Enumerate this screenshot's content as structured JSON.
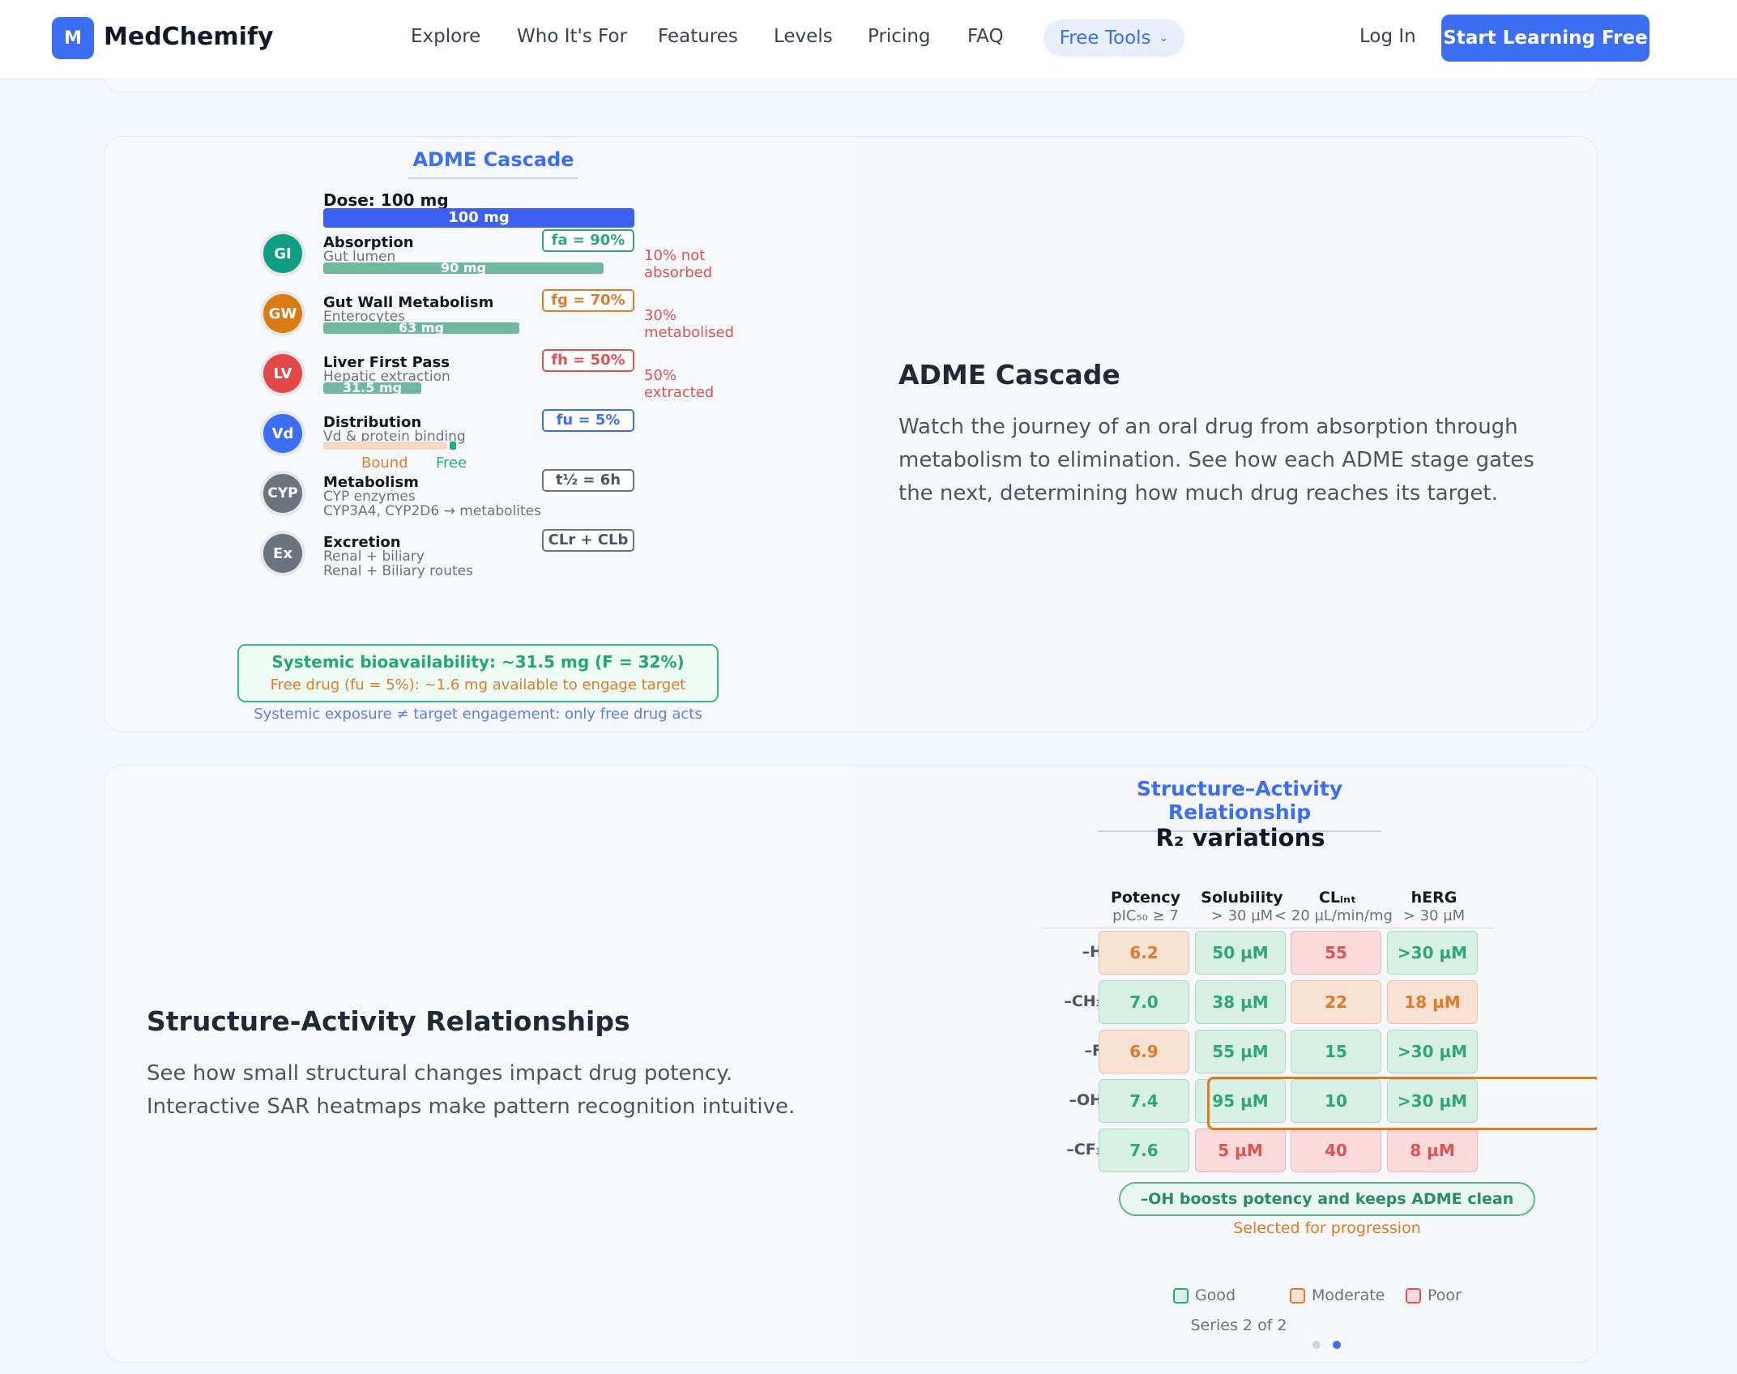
{
  "nav": {
    "logo_letter": "M",
    "brand": "MedChemify",
    "links": [
      "Explore",
      "Who It's For",
      "Features",
      "Levels",
      "Pricing",
      "FAQ"
    ],
    "free_tools": "Free Tools",
    "login": "Log In",
    "cta": "Start Learning Free"
  },
  "adme": {
    "heading": "ADME Cascade",
    "dose_label": "Dose: 100 mg",
    "dose_bar": "100 mg",
    "stages": [
      {
        "badge": "GI",
        "name": "Absorption",
        "sub": "Gut lumen",
        "bar": "90 mg",
        "fraction": 0.9,
        "pill": "fa = 90%",
        "loss1": "10% not",
        "loss2": "absorbed",
        "color": "#0f9d83"
      },
      {
        "badge": "GW",
        "name": "Gut Wall Metabolism",
        "sub": "Enterocytes",
        "bar": "63 mg",
        "fraction": 0.63,
        "pill": "fg = 70%",
        "loss1": "30%",
        "loss2": "metabolised",
        "color": "#d97a12"
      },
      {
        "badge": "LV",
        "name": "Liver First Pass",
        "sub": "Hepatic extraction",
        "bar": "31.5 mg",
        "fraction": 0.315,
        "pill": "fh = 50%",
        "loss1": "50%",
        "loss2": "extracted",
        "color": "#e24848"
      },
      {
        "badge": "Vd",
        "name": "Distribution",
        "sub": "Vd & protein binding",
        "pill": "fu = 5%",
        "bound": "Bound",
        "free": "Free",
        "color": "#3b6ef2"
      },
      {
        "badge": "CYP",
        "name": "Metabolism",
        "sub": "CYP enzymes",
        "sub2": "CYP3A4, CYP2D6 → metabolites",
        "pill": "t½ = 6h",
        "color": "#6b7280"
      },
      {
        "badge": "Ex",
        "name": "Excretion",
        "sub": "Renal + biliary",
        "sub2": "Renal + Biliary routes",
        "pill": "CLr + CLb",
        "color": "#6b7280"
      }
    ],
    "bio_main": "Systemic bioavailability: ~31.5 mg (F = 32%)",
    "bio_sub": "Free drug (fu = 5%): ~1.6 mg available to engage target",
    "bio_note": "Systemic exposure ≠ target engagement: only free drug acts",
    "title": "ADME Cascade",
    "desc": "Watch the journey of an oral drug from absorption through metabolism to elimination. See how each ADME stage gates the next, determining how much drug reaches its target."
  },
  "sar": {
    "title": "Structure-Activity Relationships",
    "desc": "See how small structural changes impact drug potency. Interactive SAR heatmaps make pattern recognition intuitive.",
    "heading": "Structure–Activity Relationship",
    "sub": "R₂ variations",
    "columns": [
      {
        "name": "Potency",
        "crit": "pIC₅₀ ≥ 7"
      },
      {
        "name": "Solubility",
        "crit": "> 30 µM"
      },
      {
        "name": "CLᵢₙₜ",
        "crit": "< 20 µL/min/mg"
      },
      {
        "name": "hERG",
        "crit": "> 30 µM"
      }
    ],
    "rows": [
      {
        "label": "–H",
        "cells": [
          {
            "v": "6.2",
            "c": "mod"
          },
          {
            "v": "50 µM",
            "c": "good"
          },
          {
            "v": "55",
            "c": "poor"
          },
          {
            "v": ">30 µM",
            "c": "good"
          }
        ]
      },
      {
        "label": "–CH₃",
        "cells": [
          {
            "v": "7.0",
            "c": "good"
          },
          {
            "v": "38 µM",
            "c": "good"
          },
          {
            "v": "22",
            "c": "mod"
          },
          {
            "v": "18 µM",
            "c": "mod"
          }
        ]
      },
      {
        "label": "–F",
        "cells": [
          {
            "v": "6.9",
            "c": "mod"
          },
          {
            "v": "55 µM",
            "c": "good"
          },
          {
            "v": "15",
            "c": "good"
          },
          {
            "v": ">30 µM",
            "c": "good"
          }
        ]
      },
      {
        "label": "–OH",
        "cells": [
          {
            "v": "7.4",
            "c": "good"
          },
          {
            "v": "95 µM",
            "c": "good"
          },
          {
            "v": "10",
            "c": "good"
          },
          {
            "v": ">30 µM",
            "c": "good"
          }
        ]
      },
      {
        "label": "–CF₃",
        "cells": [
          {
            "v": "7.6",
            "c": "good"
          },
          {
            "v": "5 µM",
            "c": "poor"
          },
          {
            "v": "40",
            "c": "poor"
          },
          {
            "v": "8 µM",
            "c": "poor"
          }
        ]
      }
    ],
    "selected_row": 3,
    "verdict": "–OH boosts potency and keeps ADME clean",
    "verdict_sub": "Selected for progression",
    "legend": {
      "good": "Good",
      "moderate": "Moderate",
      "poor": "Poor"
    },
    "series": "Series 2 of 2",
    "active_dot": 1,
    "dot_count": 2
  },
  "colors": {
    "accent": "#3b6ef2",
    "good": "#2fa57a",
    "moderate": "#df7a2a",
    "poor": "#e05252"
  }
}
